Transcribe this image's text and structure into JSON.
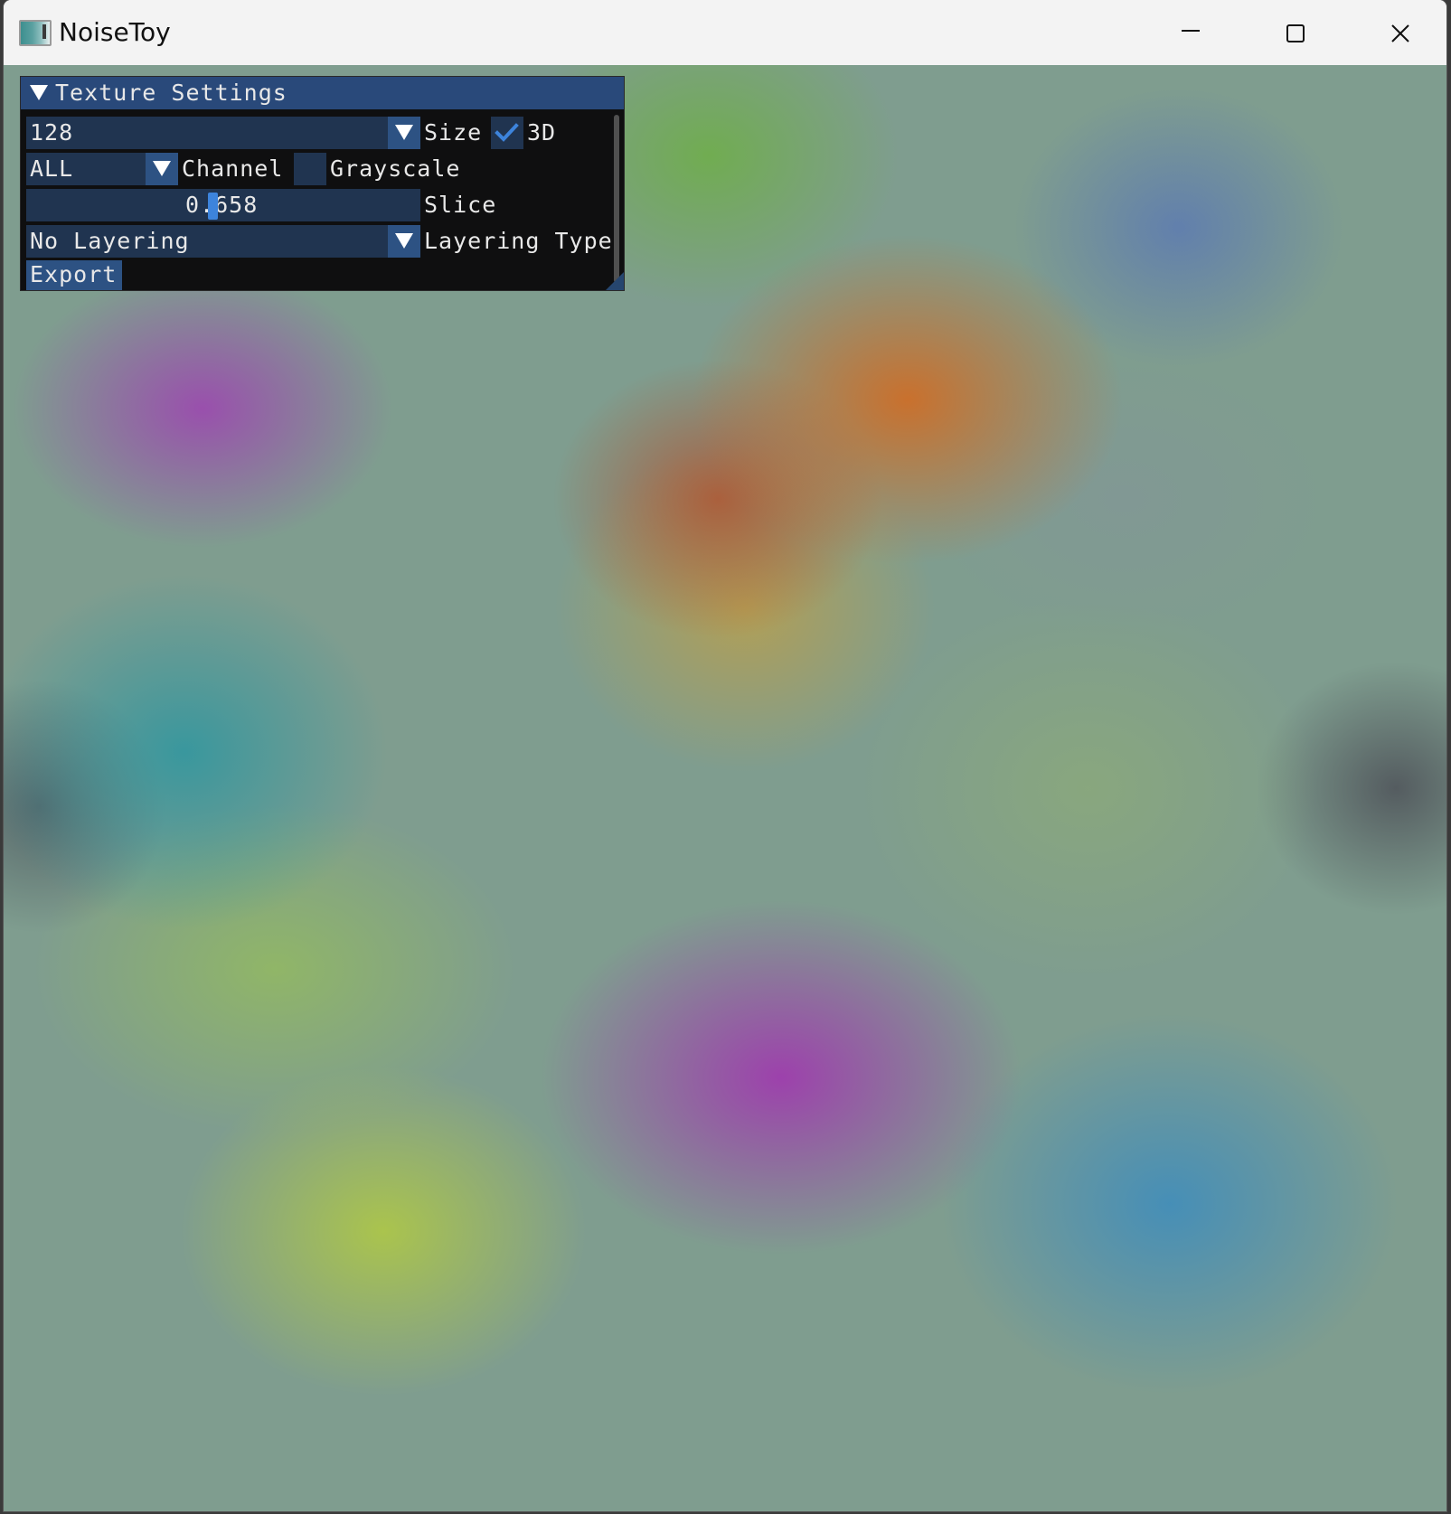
{
  "window": {
    "title": "NoiseToy"
  },
  "panel": {
    "title": "Texture Settings",
    "size": {
      "value": "128",
      "label": "Size"
    },
    "three_d": {
      "label": "3D",
      "checked": true
    },
    "channel": {
      "value": "ALL",
      "label": "Channel"
    },
    "grayscale": {
      "label": "Grayscale",
      "checked": false
    },
    "slice": {
      "value": "0.658",
      "label": "Slice",
      "fraction": 0.658
    },
    "layering": {
      "value": "No Layering",
      "label": "Layering Type"
    },
    "export_label": "Export"
  },
  "colors": {
    "header": "#29497a",
    "frame": "#203450",
    "button": "#2d5283",
    "accent": "#3d84dc"
  },
  "icons": {
    "minimize": "minimize-icon",
    "maximize": "maximize-icon",
    "close": "close-icon",
    "checkmark": "checkmark-icon",
    "dropdown": "triangle-down-icon"
  }
}
